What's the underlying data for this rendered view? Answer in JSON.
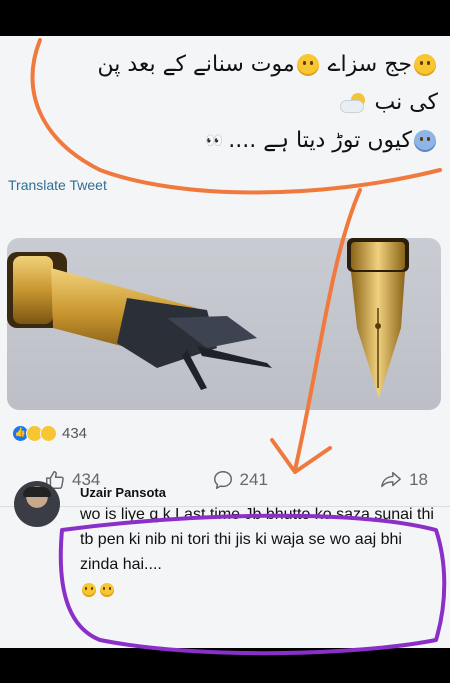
{
  "post": {
    "urdu_line1_part1": "جج سزاے",
    "urdu_line1_part2": "موت سنانے کے بعد پن",
    "urdu_line2": "کی نب",
    "urdu_line3_part1": "کیوں توڑ دیتا ہے ....",
    "translate_label": "Translate Tweet"
  },
  "reactions": {
    "count": "434"
  },
  "actions": {
    "like_count": "434",
    "comment_count": "241",
    "share_count": "18"
  },
  "comment": {
    "author": "Uzair Pansota",
    "text": "wo is liye q k Last time Jb bhutto ko saza sunai thi tb pen ki nib ni tori thi jis ki waja se wo aaj bhi zinda hai...."
  },
  "icons": {
    "like": "thumbs-up-icon",
    "comment": "comment-bubble-icon",
    "share": "share-arrow-icon"
  },
  "colors": {
    "annotation_orange": "#f07a3e",
    "annotation_purple": "#8b2fc9",
    "link_blue": "#2f6f93",
    "facebook_blue": "#1877f2"
  }
}
